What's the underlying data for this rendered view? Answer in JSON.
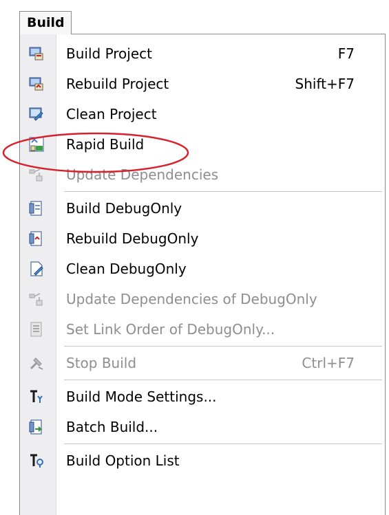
{
  "menu": {
    "title": "Build",
    "items": [
      {
        "label": "Build Project",
        "shortcut": "F7",
        "icon": "build-project-icon",
        "enabled": true
      },
      {
        "label": "Rebuild Project",
        "shortcut": "Shift+F7",
        "icon": "rebuild-project-icon",
        "enabled": true
      },
      {
        "label": "Clean Project",
        "shortcut": "",
        "icon": "clean-project-icon",
        "enabled": true
      },
      {
        "label": "Rapid Build",
        "shortcut": "",
        "icon": "rapid-build-icon",
        "enabled": true
      },
      {
        "label": "Update Dependencies",
        "shortcut": "",
        "icon": "update-dependencies-icon",
        "enabled": false
      },
      {
        "label": "Build DebugOnly",
        "shortcut": "",
        "icon": "build-debugonly-icon",
        "enabled": true
      },
      {
        "label": "Rebuild DebugOnly",
        "shortcut": "",
        "icon": "rebuild-debugonly-icon",
        "enabled": true
      },
      {
        "label": "Clean DebugOnly",
        "shortcut": "",
        "icon": "clean-debugonly-icon",
        "enabled": true
      },
      {
        "label": "Update Dependencies of DebugOnly",
        "shortcut": "",
        "icon": "update-dependencies-debugonly-icon",
        "enabled": false
      },
      {
        "label": "Set Link Order of DebugOnly...",
        "shortcut": "",
        "icon": "set-link-order-icon",
        "enabled": false
      },
      {
        "label": "Stop Build",
        "shortcut": "Ctrl+F7",
        "icon": "stop-build-icon",
        "enabled": false
      },
      {
        "label": "Build Mode Settings...",
        "shortcut": "",
        "icon": "build-mode-settings-icon",
        "enabled": true
      },
      {
        "label": "Batch Build...",
        "shortcut": "",
        "icon": "batch-build-icon",
        "enabled": true
      },
      {
        "label": "Build Option List",
        "shortcut": "",
        "icon": "build-option-list-icon",
        "enabled": true
      }
    ]
  },
  "annotation": {
    "highlighted_item": "Rapid Build",
    "color": "#d8202a"
  }
}
